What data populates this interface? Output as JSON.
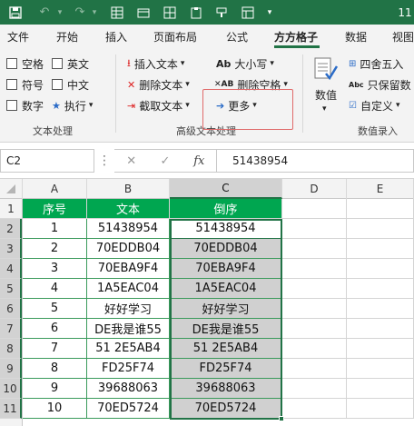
{
  "title_bar": {
    "app_icon": "save-icon",
    "undo_icon": "undo-icon",
    "redo_icon": "redo-icon",
    "quick_icons": [
      "table-icon",
      "format-icon",
      "grid-icon",
      "clipboard-icon",
      "paint-icon",
      "customize-icon"
    ],
    "title_text": "11"
  },
  "tabs": [
    "文件",
    "开始",
    "插入",
    "页面布局",
    "公式",
    "方方格子",
    "数据",
    "视图"
  ],
  "active_tab": "方方格子",
  "ribbon": {
    "text_group": {
      "items": [
        "空格",
        "英文",
        "符号",
        "中文",
        "数字",
        "执行"
      ],
      "label": "文本处理"
    },
    "advanced_group": {
      "insert": "插入文本",
      "delete": "删除文本",
      "extract": "截取文本",
      "case": "大小写",
      "delete_space": "删除空格",
      "more": "更多",
      "label": "高级文本处理"
    },
    "number_group": {
      "value_label": "数值",
      "round": "四舍五入",
      "keep": "只保留数",
      "custom": "自定义",
      "label": "数值录入"
    }
  },
  "formula_bar": {
    "name_box": "C2",
    "fx_label": "fx",
    "cancel": "✕",
    "confirm": "✓",
    "value": "51438954"
  },
  "columns": [
    "A",
    "B",
    "C",
    "D",
    "E"
  ],
  "rows": [
    "1",
    "2",
    "3",
    "4",
    "5",
    "6",
    "7",
    "8",
    "9",
    "10",
    "11"
  ],
  "sheet": {
    "headers": [
      "序号",
      "文本",
      "倒序"
    ],
    "data": [
      [
        "1",
        "51438954",
        "51438954"
      ],
      [
        "2",
        "70EDDB04",
        "70EDDB04"
      ],
      [
        "3",
        "70EBA9F4",
        "70EBA9F4"
      ],
      [
        "4",
        "1A5EAC04",
        "1A5EAC04"
      ],
      [
        "5",
        "好好学习",
        "好好学习"
      ],
      [
        "6",
        "DE我是谁55",
        "DE我是谁55"
      ],
      [
        "7",
        "51 2E5AB4",
        "51 2E5AB4"
      ],
      [
        "8",
        "FD25F74",
        "FD25F74"
      ],
      [
        "9",
        "39688063",
        "39688063"
      ],
      [
        "10",
        "70ED5724",
        "70ED5724"
      ]
    ]
  },
  "colors": {
    "accent": "#217346",
    "header_fill": "#00a650",
    "selection_fill": "#d0d0d0",
    "highlight_border": "#e06a6a"
  }
}
